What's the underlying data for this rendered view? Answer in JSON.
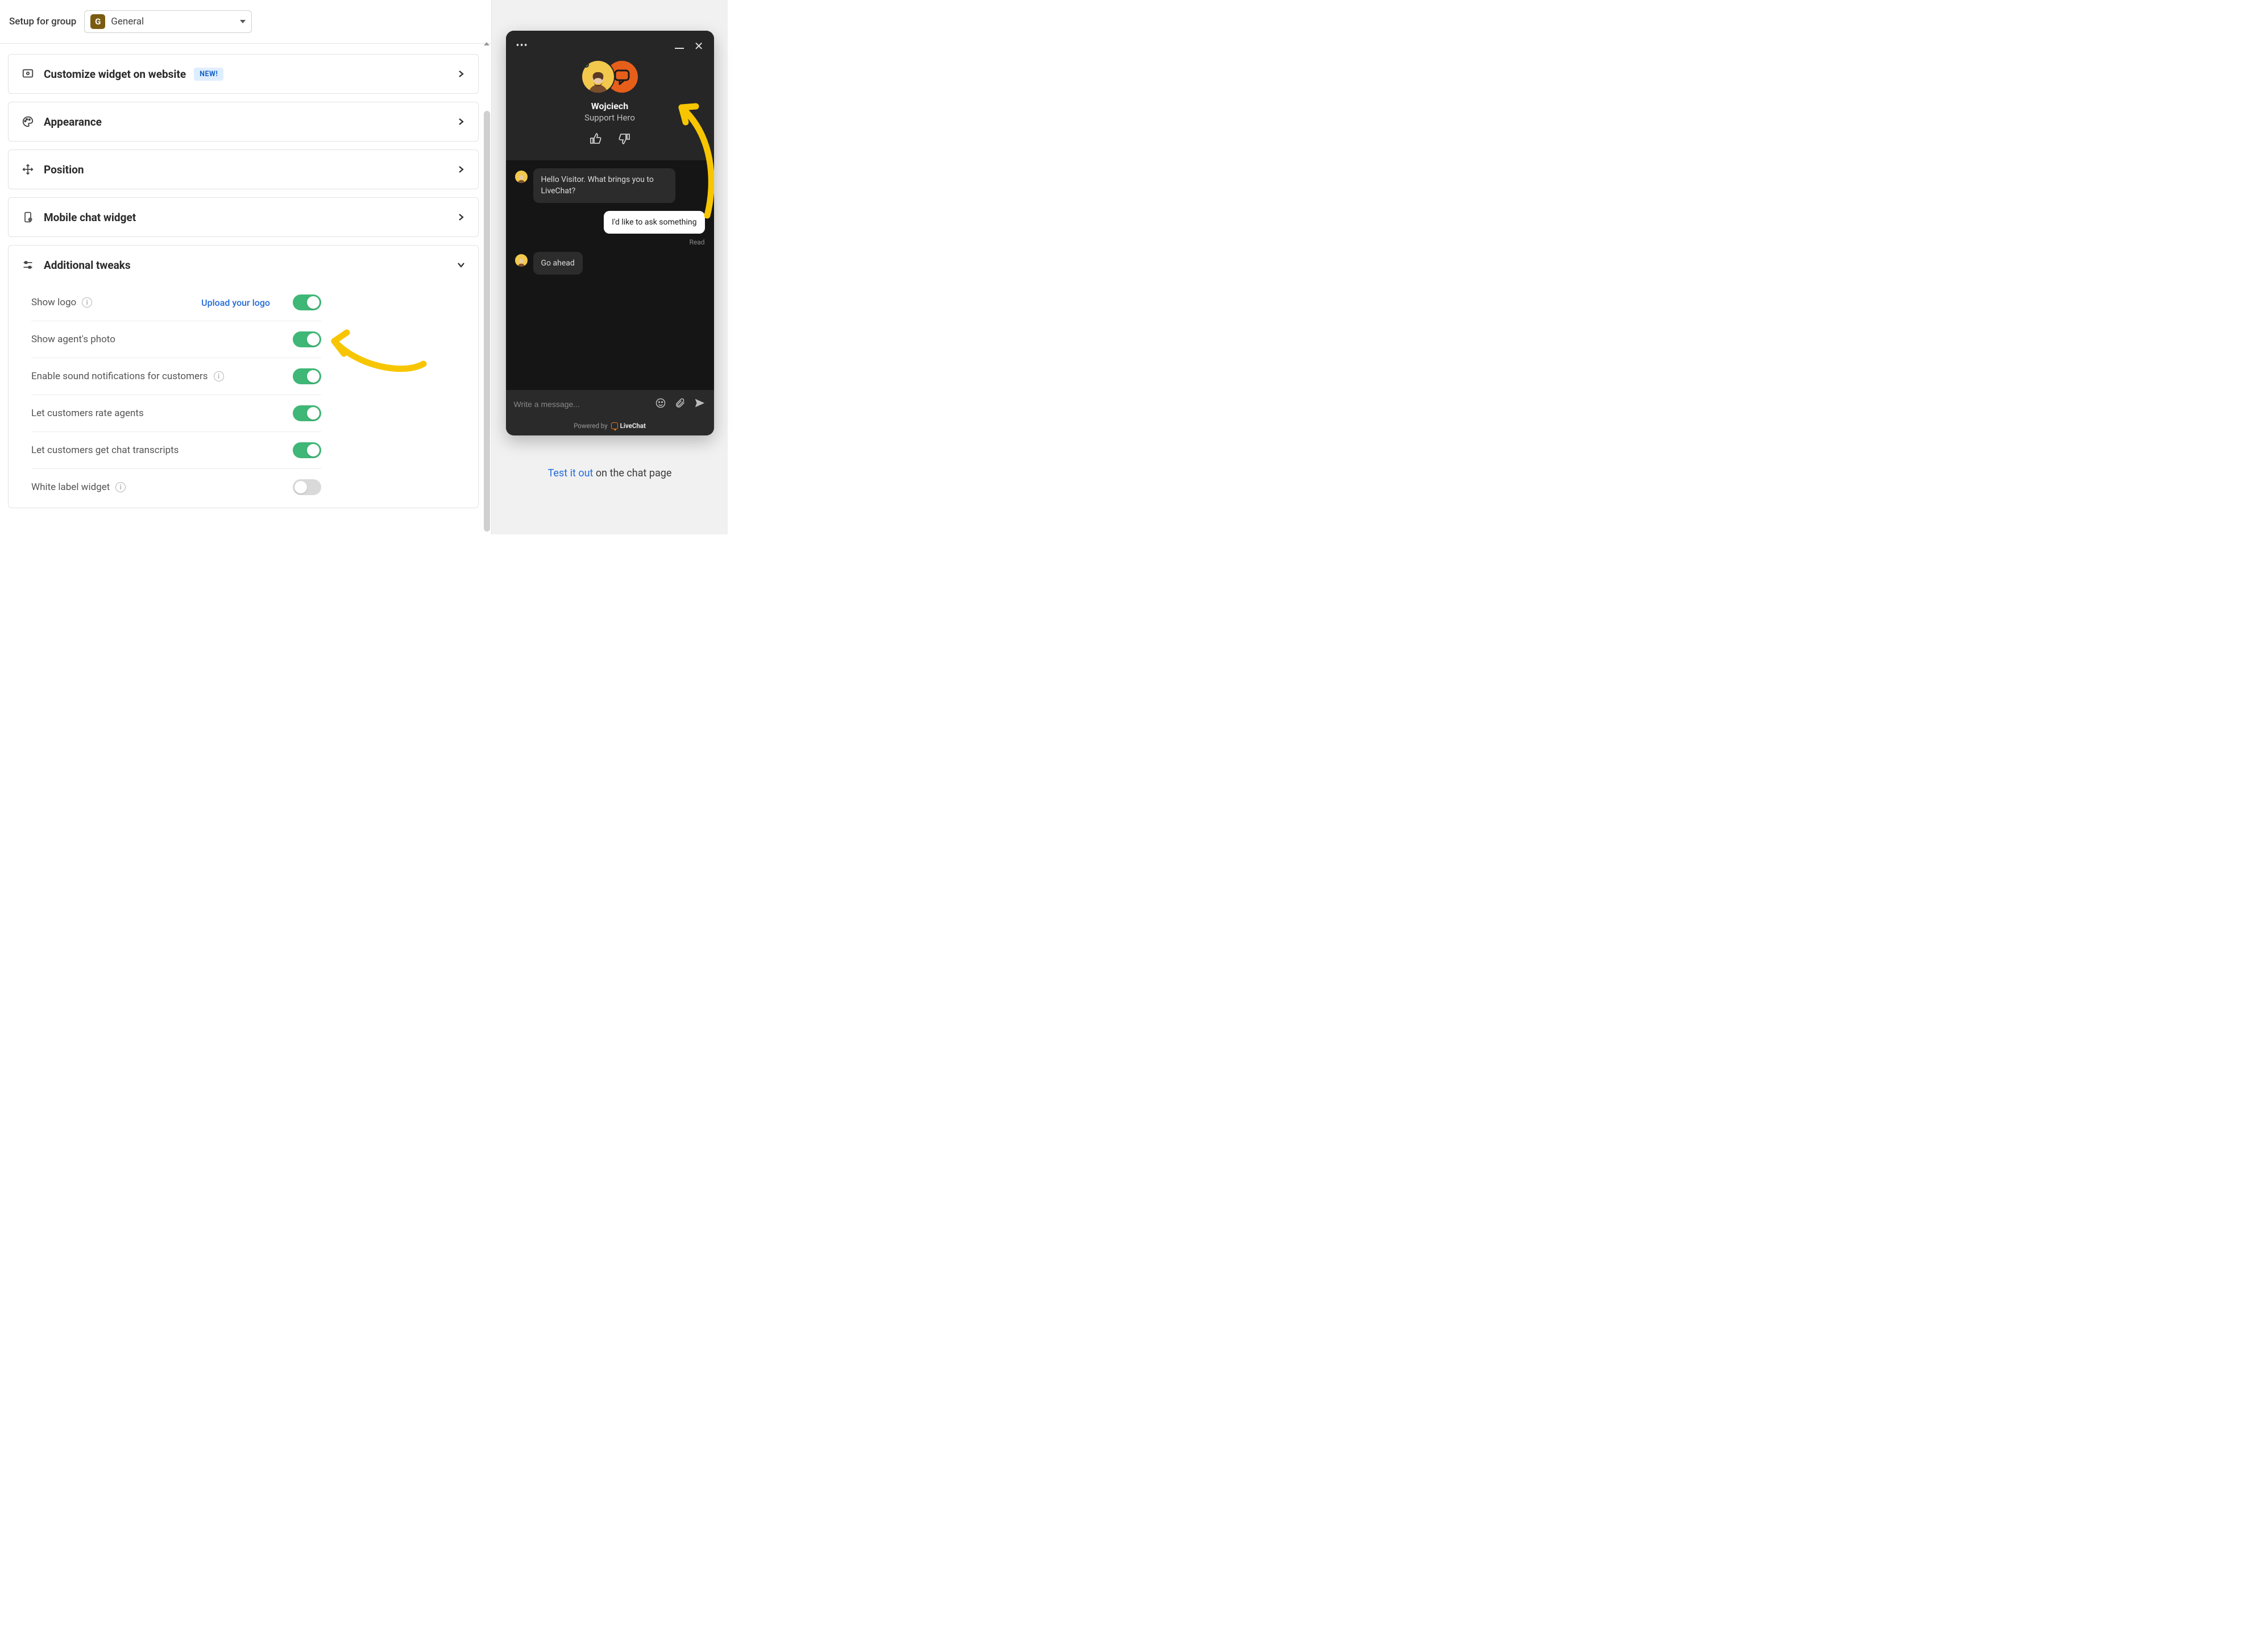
{
  "topbar": {
    "label": "Setup for group",
    "group_badge": "G",
    "group_name": "General"
  },
  "panels": {
    "customize": {
      "title": "Customize widget on website",
      "badge": "NEW!"
    },
    "appearance": {
      "title": "Appearance"
    },
    "position": {
      "title": "Position"
    },
    "mobile": {
      "title": "Mobile chat widget"
    },
    "tweaks": {
      "title": "Additional tweaks"
    }
  },
  "tweaks": {
    "upload_link": "Upload your logo",
    "rows": [
      {
        "label": "Show logo",
        "info": true,
        "on": true
      },
      {
        "label": "Show agent's photo",
        "info": false,
        "on": true
      },
      {
        "label": "Enable sound notifications for customers",
        "info": true,
        "on": true
      },
      {
        "label": "Let customers rate agents",
        "info": false,
        "on": true
      },
      {
        "label": "Let customers get chat transcripts",
        "info": false,
        "on": true
      },
      {
        "label": "White label widget",
        "info": true,
        "on": false
      }
    ]
  },
  "preview": {
    "agent_name": "Wojciech",
    "agent_role": "Support Hero",
    "messages": {
      "m1": "Hello Visitor. What brings you to LiveChat?",
      "m2": "I'd like to ask something",
      "m3": "Go ahead"
    },
    "read_label": "Read",
    "input_placeholder": "Write a message...",
    "powered_prefix": "Powered by",
    "brand": "LiveChat"
  },
  "test": {
    "link": "Test it out",
    "suffix": " on the chat page"
  }
}
